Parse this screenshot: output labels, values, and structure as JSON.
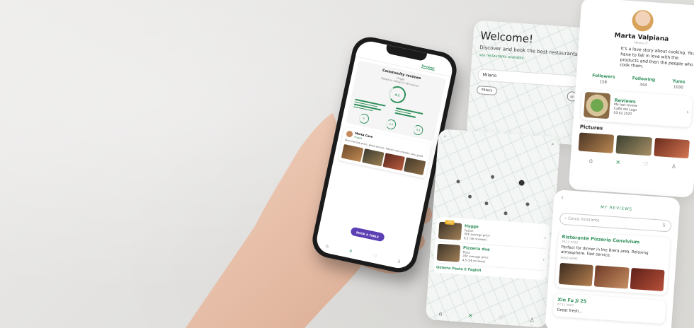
{
  "phone": {
    "tabs": [
      "",
      "",
      "Reviews"
    ],
    "community_title": "Community reviews",
    "community_sub": "Hugga",
    "community_note": "Based on ratings in 48 reviews",
    "main_score": "4.1",
    "scores": [
      "4",
      "4.4",
      "4.3"
    ],
    "review_name": "Marta Case",
    "review_restaurant": "Hugga",
    "review_text": "Nice and top price, good service. Ramen and noodles very good",
    "book_button": "BOOK A TABLE",
    "nav": [
      "⌂",
      "✕",
      "♡",
      "♙"
    ]
  },
  "welcome": {
    "title": "Welcome!",
    "description": "Discover and book the best restaurants",
    "link": "see restaurants available",
    "city": "Milano",
    "filters": "Filters"
  },
  "maplist": {
    "restaurants": [
      {
        "name": "Hygge",
        "type": "Fusion",
        "price": "35€ average price",
        "rating": "9,3 (16 reviews)",
        "badge": "-20%"
      },
      {
        "name": "Pizzeria due",
        "type": "Pizza",
        "price": "20€ average price",
        "rating": "4,5 (26 reviews)"
      }
    ],
    "last_name": "Osteria Pasta E Fagioli",
    "nav": [
      "⌂",
      "✕",
      "♡",
      "♙"
    ]
  },
  "profile": {
    "name": "Marta Valpiana",
    "subtitle": "Milano, IT",
    "bio": "It's a love story about cooking. You have to fall in love with the products and then the people who cook them.",
    "stats": [
      {
        "label": "Followers",
        "value": "158"
      },
      {
        "label": "Following",
        "value": "344"
      },
      {
        "label": "Yums",
        "value": "1030"
      }
    ],
    "reviews_title": "Reviews",
    "reviews_line1": "My last review",
    "reviews_line2": "Caffè del Lago",
    "reviews_date": "03.02.2020",
    "pictures_title": "Pictures",
    "nav": [
      "⌂",
      "✕",
      "♡",
      "♙"
    ]
  },
  "myreviews": {
    "title": "MY REVIEWS",
    "search_placeholder": "Cerca ristorante",
    "items": [
      {
        "name": "Ristorante Pizzeria Convivium",
        "date": "26.12.2020",
        "text": "Perfect for dinner in the Brera area. Relaxing atmosphere. Fast service.",
        "more": "READ MORE"
      },
      {
        "name": "Xin Fu Ji 25",
        "date": "27.11.2020",
        "text": "Great fresh..."
      }
    ]
  },
  "colors": {
    "accent_green": "#2f8f5b",
    "book_purple": "#5b3fb3",
    "phone_body": "#1b1b1c"
  }
}
